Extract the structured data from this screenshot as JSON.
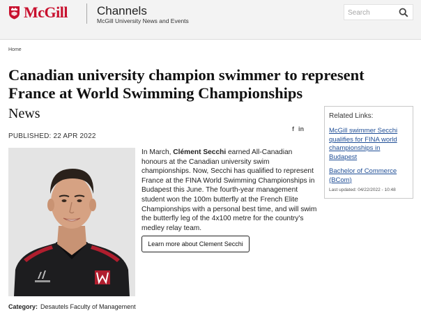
{
  "header": {
    "logo_text": "McGill",
    "channels_title": "Channels",
    "channels_subtitle": "McGill University News and Events",
    "search_placeholder": "Search"
  },
  "breadcrumb": {
    "home": "Home"
  },
  "article": {
    "title": "Canadian university champion swimmer to represent France at World Swimming Championships",
    "section": "News",
    "published_label": "PUBLISHED:",
    "published_date": "22 APR 2022",
    "body_intro": "In March, ",
    "body_name": "Clément Secchi",
    "body_rest": " earned All-Canadian honours at the Canadian university swim championships. Now, Secchi has qualified to represent France at the FINA World Swimming Championships in Budapest this June. The fourth-year management student won the 100m butterfly at the French Elite Championships with a personal best time, and will swim the butterfly leg of the 4x100 metre for the country's medley relay team.",
    "learn_more_label": "Learn more about Clement Secchi",
    "category_label": "Category:",
    "category_value": "Desautels Faculty of Management"
  },
  "social": {
    "facebook": "f",
    "linkedin": "in"
  },
  "related_links": {
    "title": "Related Links:",
    "links": [
      "McGill swimmer Secchi qualifies for FINA world championships in Budapest",
      "Bachelor of Commerce (BCom)"
    ],
    "updated": "Last updated: 04/22/2022 - 10:48"
  },
  "colors": {
    "brand_red": "#c8102e",
    "link_blue": "#1f4e96",
    "header_bg": "#f3f3f3"
  },
  "icons": [
    "mcgill-crest-icon",
    "search-icon",
    "facebook-icon",
    "linkedin-icon"
  ]
}
